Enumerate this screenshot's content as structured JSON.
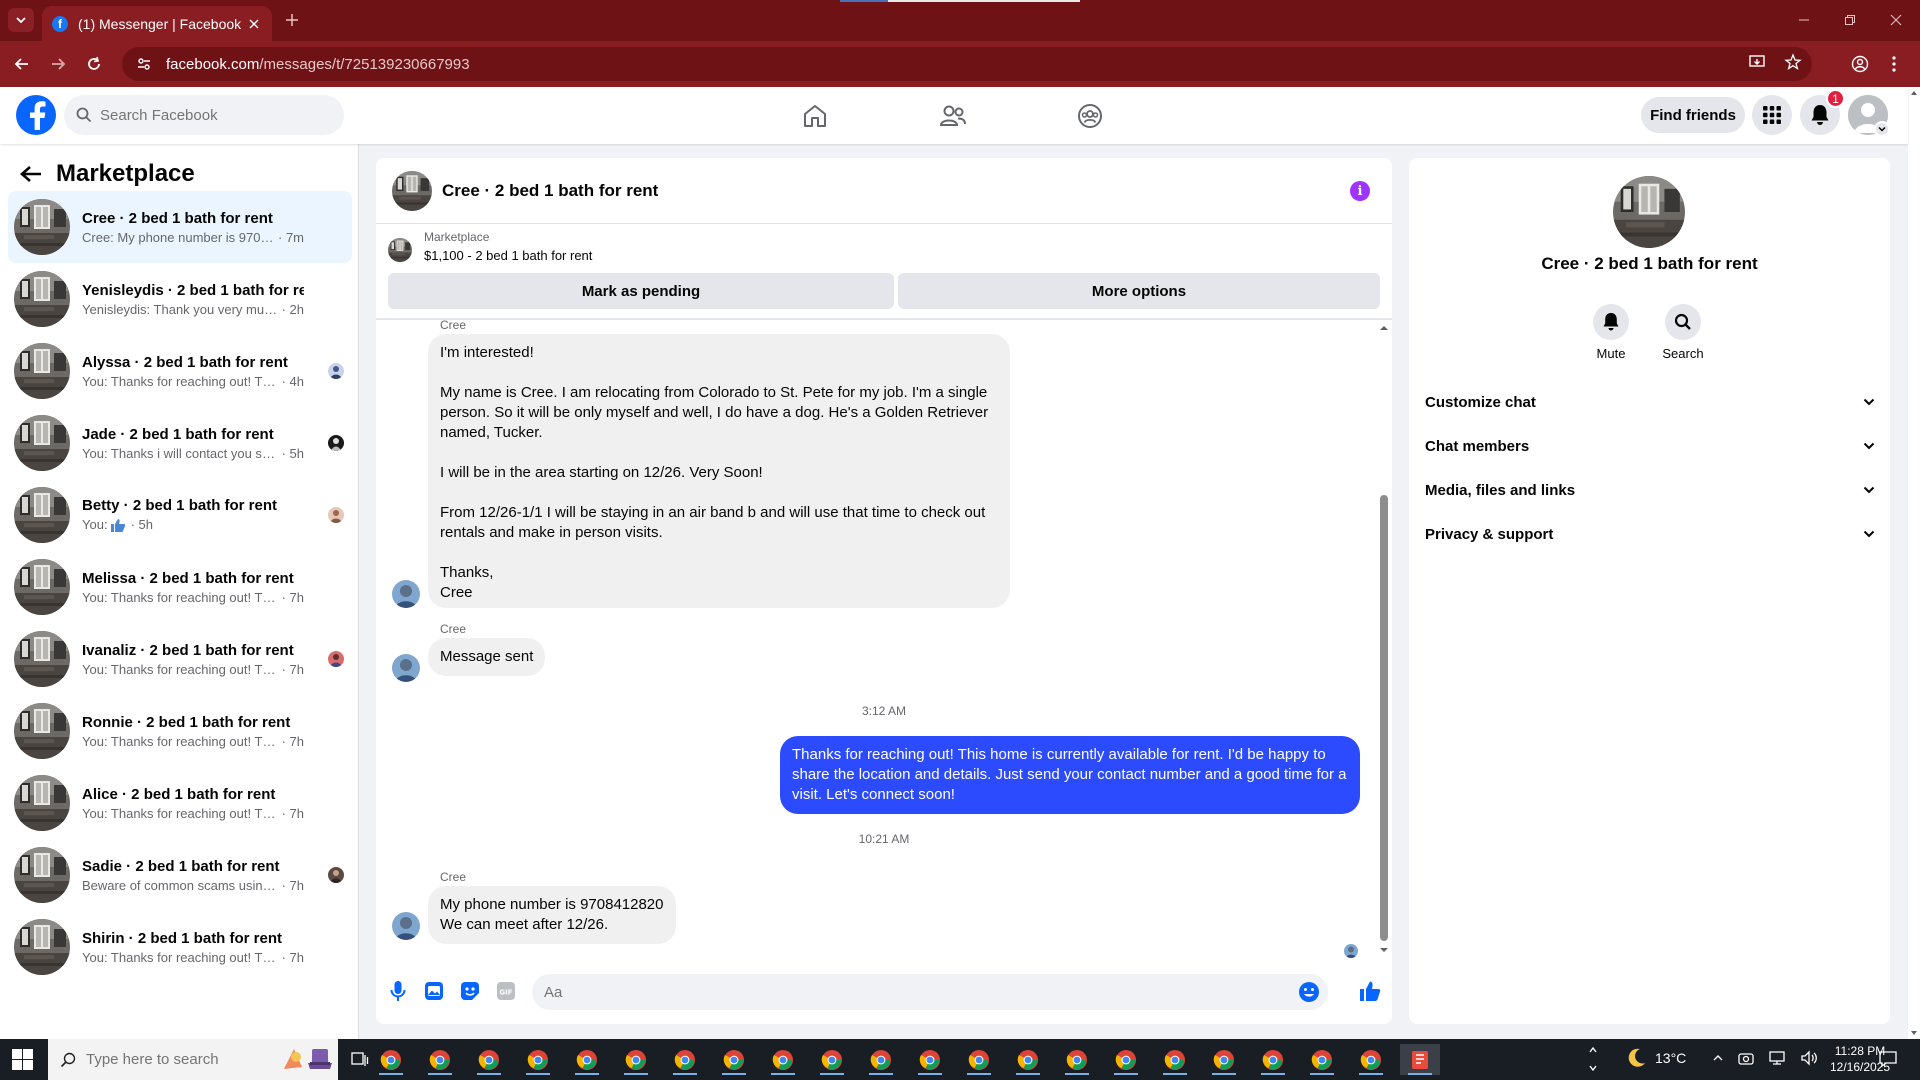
{
  "browser": {
    "tab_title": "(1) Messenger | Facebook",
    "url_host": "facebook.com",
    "url_path": "/messages/t/725139230667993"
  },
  "header": {
    "search_placeholder": "Search Facebook",
    "find_friends_label": "Find friends",
    "notification_count": "1"
  },
  "sidebar": {
    "title": "Marketplace",
    "chats": [
      {
        "name": "Cree · 2 bed 1 bath for rent",
        "preview": "Cree: My phone number is 97084128...",
        "time": "· 7m",
        "active": true
      },
      {
        "name": "Yenisleydis · 2 bed 1 bath for rent",
        "preview": "Yenisleydis: Thank you very much, I w...",
        "time": "· 2h"
      },
      {
        "name": "Alyssa · 2 bed 1 bath for rent",
        "preview": "You: Thanks for reaching out! This ...",
        "time": "· 4h"
      },
      {
        "name": "Jade · 2 bed 1 bath for rent",
        "preview": "You: Thanks i will contact you soon",
        "time": "· 5h"
      },
      {
        "name": "Betty · 2 bed 1 bath for rent",
        "preview": "You: ",
        "time": "· 5h"
      },
      {
        "name": "Melissa · 2 bed 1 bath for rent",
        "preview": "You: Thanks for reaching out! This ho...",
        "time": "· 7h"
      },
      {
        "name": "Ivanaliz · 2 bed 1 bath for rent",
        "preview": "You: Thanks for reaching out! This ...",
        "time": "· 7h"
      },
      {
        "name": "Ronnie · 2 bed 1 bath for rent",
        "preview": "You: Thanks for reaching out! This ho...",
        "time": "· 7h"
      },
      {
        "name": "Alice · 2 bed 1 bath for rent",
        "preview": "You: Thanks for reaching out! This ho...",
        "time": "· 7h"
      },
      {
        "name": "Sadie · 2 bed 1 bath for rent",
        "preview": "Beware of common scams using p...",
        "time": "· 7h"
      },
      {
        "name": "Shirin · 2 bed 1 bath for rent",
        "preview": "You: Thanks for reaching out! This ho...",
        "time": "· 7h"
      }
    ]
  },
  "conversation": {
    "title": "Cree · 2 bed 1 bath for rent",
    "listing_source": "Marketplace",
    "listing_summary": "$1,100 - 2 bed 1 bath for rent",
    "mark_pending_label": "Mark as pending",
    "more_options_label": "More options",
    "messages": [
      {
        "sender": "Cree",
        "lines": [
          "I'm interested!",
          "",
          "My name is Cree. I am relocating from Colorado to St. Pete for my job. I'm a single",
          "person. So it will be only myself and well, I do have a dog. He's a Golden  Retriever",
          "named, Tucker.",
          "",
          "I will be in the area starting on 12/26. Very Soon!",
          "",
          "From 12/26-1/1 I will be staying in an air band b and will use that time to check out",
          "rentals and make in person visits.",
          "",
          "Thanks,",
          "Cree"
        ]
      },
      {
        "sender": "Cree",
        "text": "Message sent"
      },
      {
        "timestamp": "3:12 AM"
      },
      {
        "sender": "You",
        "lines": [
          "Thanks for reaching out! This home is currently available for rent. I'd be happy to",
          "share the location and details. Just send your contact number and a good time for a",
          "visit. Let's connect soon!"
        ]
      },
      {
        "timestamp": "10:21 AM"
      },
      {
        "sender": "Cree",
        "lines": [
          "My phone number is 9708412820",
          "We can meet after 12/26."
        ]
      }
    ],
    "composer_placeholder": "Aa"
  },
  "details": {
    "title": "Cree · 2 bed 1 bath for rent",
    "mute_label": "Mute",
    "search_label": "Search",
    "sections": [
      "Customize chat",
      "Chat members",
      "Media, files and links",
      "Privacy & support"
    ]
  },
  "taskbar": {
    "search_placeholder": "Type here to search",
    "temperature": "13°C",
    "time": "11:28 PM",
    "date": "12/16/2025"
  },
  "colors": {
    "fb_blue": "#0866ff",
    "outgoing_bubble": "#2c4bff",
    "browser_frame": "#6e1216",
    "badge_red": "#e41e3f"
  }
}
